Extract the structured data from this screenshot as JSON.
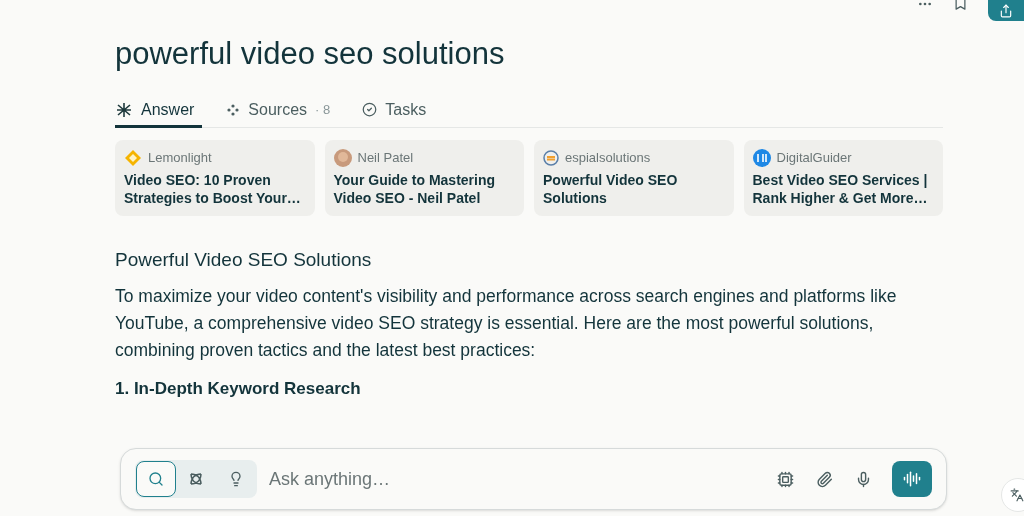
{
  "title": "powerful video seo solutions",
  "tabs": [
    {
      "label": "Answer",
      "selected": true
    },
    {
      "label": "Sources",
      "count": "· 8",
      "selected": false
    },
    {
      "label": "Tasks",
      "selected": false
    }
  ],
  "sources": [
    {
      "site": "Lemonlight",
      "title": "Video SEO: 10 Proven Strategies to Boost Your…"
    },
    {
      "site": "Neil Patel",
      "title": "Your Guide to Mastering Video SEO - Neil Patel"
    },
    {
      "site": "espialsolutions",
      "title": "Powerful Video SEO Solutions"
    },
    {
      "site": "DigitalGuider",
      "title": "Best Video SEO Services | Rank Higher & Get More…"
    }
  ],
  "answer": {
    "heading": "Powerful Video SEO Solutions",
    "paragraph": "To maximize your video content's visibility and performance across search engines and platforms like YouTube, a comprehensive video SEO strategy is essential. Here are the most powerful solutions, combining proven tactics and the latest best practices:",
    "subheading": "1. In-Depth Keyword Research"
  },
  "ask_bar": {
    "placeholder": "Ask anything…",
    "modes": [
      {
        "selected": true
      },
      {
        "selected": false
      },
      {
        "selected": false
      }
    ]
  }
}
